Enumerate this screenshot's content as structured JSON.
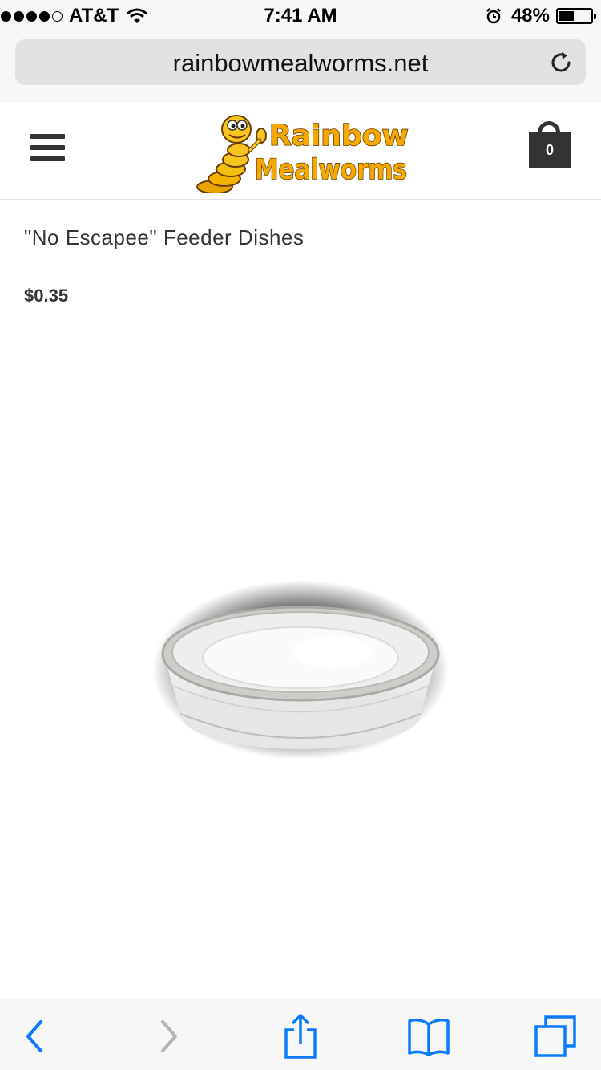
{
  "status_bar": {
    "carrier": "AT&T",
    "time": "7:41 AM",
    "battery_percent": "48%",
    "battery_level": 0.48,
    "signal_bars_filled": 4,
    "signal_bars_total": 5,
    "icons": [
      "wifi-icon",
      "alarm-icon",
      "battery-icon"
    ]
  },
  "browser": {
    "url": "rainbowmealworms.net",
    "reload_icon": "reload-icon"
  },
  "site_header": {
    "menu_icon": "hamburger-menu-icon",
    "logo_line1": "Rainbow",
    "logo_line2": "Mealworms",
    "cart_count": "0",
    "cart_icon": "shopping-bag-icon"
  },
  "product": {
    "title": "\"No Escapee\" Feeder Dishes",
    "price": "$0.35",
    "image": "feeder-dish-image"
  },
  "toolbar": {
    "icons": [
      "back-icon",
      "forward-icon",
      "share-icon",
      "bookmarks-icon",
      "tabs-icon"
    ]
  },
  "colors": {
    "ios_blue": "#0a7aff",
    "disabled_gray": "#b4b4b4",
    "text_dark": "#333333",
    "logo_gold": "#f0a800"
  }
}
